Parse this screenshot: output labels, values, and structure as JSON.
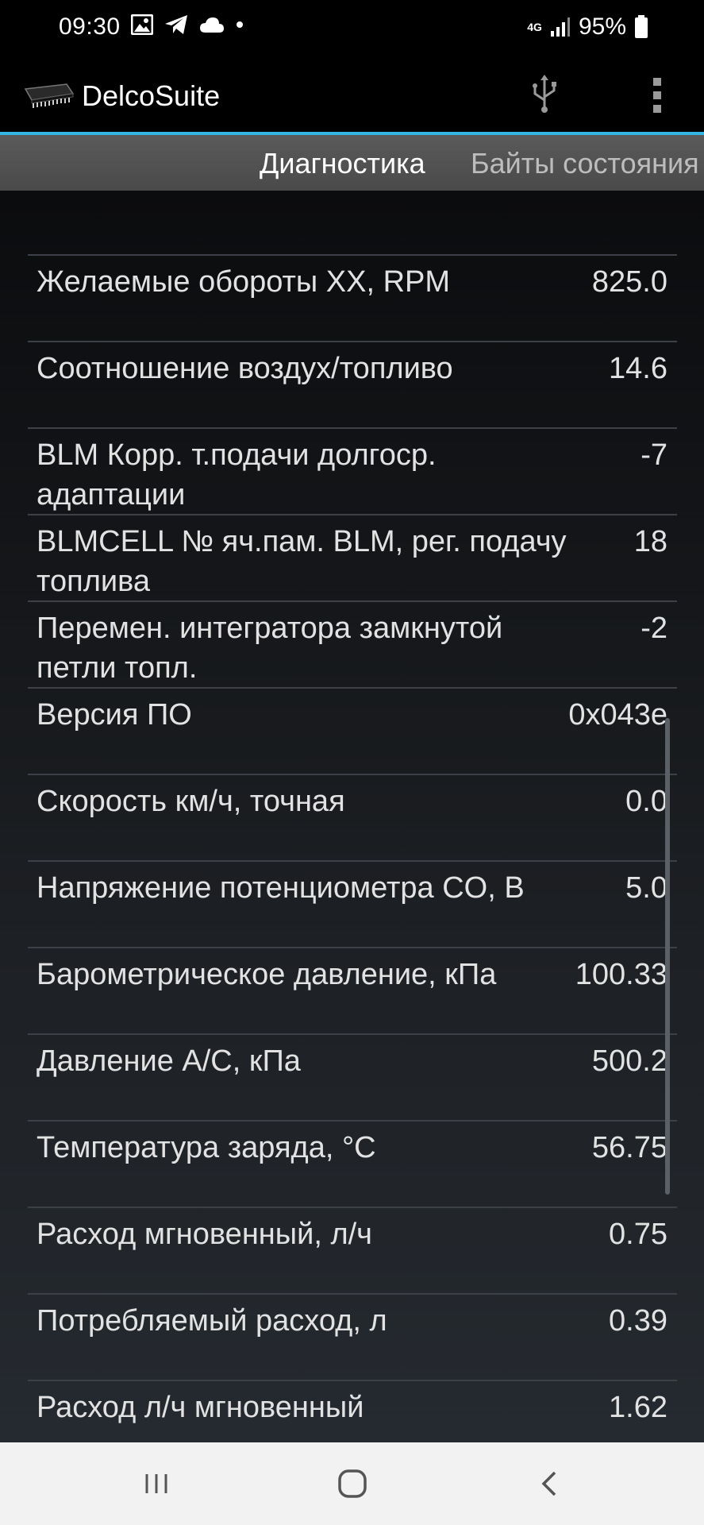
{
  "status_bar": {
    "time": "09:30",
    "network": "4G",
    "battery": "95%",
    "icons": [
      "gallery-icon",
      "telegram-icon",
      "cloud-icon",
      "dot-icon",
      "signal-icon",
      "battery-icon"
    ]
  },
  "app_bar": {
    "title": "DelcoSuite",
    "logo_icon": "chip-icon",
    "actions": [
      "usb-icon",
      "overflow-menu-icon"
    ],
    "accent_color": "#33b5e5"
  },
  "tabs": [
    {
      "label": "Диагностика",
      "active": true
    },
    {
      "label": "Байты состояния",
      "active": false
    }
  ],
  "parameters": [
    {
      "label": "Желаемые обороты XX, RPM",
      "value": "825.0"
    },
    {
      "label": "Соотношение воздух/топливо",
      "value": "14.6"
    },
    {
      "label": "BLM Корр. т.подачи долгоср. адаптации",
      "value": "-7"
    },
    {
      "label": "BLMCELL № яч.пам. BLM, рег. подачу топлива",
      "value": "18"
    },
    {
      "label": "Перемен. интегратора замкнутой петли топл.",
      "value": "-2"
    },
    {
      "label": "Версия ПО",
      "value": "0x043e"
    },
    {
      "label": "Скорость км/ч, точная",
      "value": "0.0"
    },
    {
      "label": "Напряжение потенциометра CO, В",
      "value": "5.0"
    },
    {
      "label": "Барометрическое давление, кПа",
      "value": "100.33"
    },
    {
      "label": "Давление A/C, кПа",
      "value": "500.2"
    },
    {
      "label": "Температура заряда, °C",
      "value": "56.75"
    },
    {
      "label": "Расход мгновенный, л/ч",
      "value": "0.75"
    },
    {
      "label": "Потребляемый расход, л",
      "value": "0.39"
    },
    {
      "label": "Расход л/ч мгновенный",
      "value": "1.62"
    }
  ],
  "nav_bar": {
    "buttons": [
      "recent-apps-icon",
      "home-icon",
      "back-icon"
    ]
  }
}
